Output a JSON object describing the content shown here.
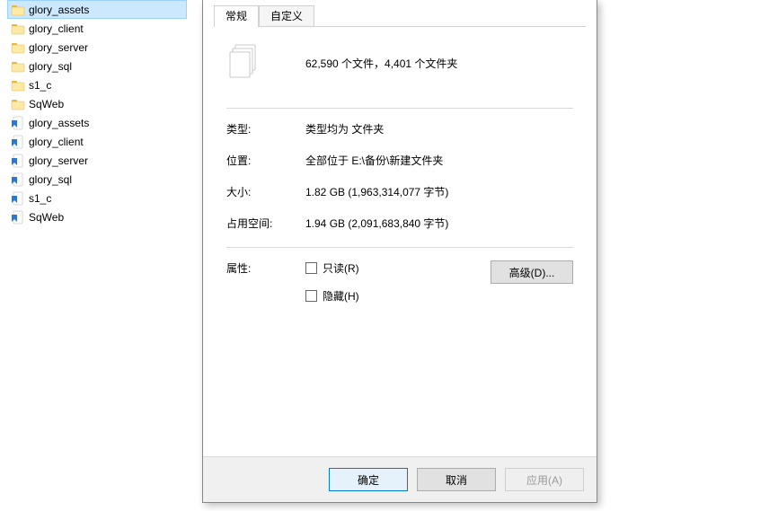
{
  "file_pane": {
    "items": [
      {
        "name": "glory_assets",
        "kind": "folder",
        "selected": true
      },
      {
        "name": "glory_client",
        "kind": "folder",
        "selected": false
      },
      {
        "name": "glory_server",
        "kind": "folder",
        "selected": false
      },
      {
        "name": "glory_sql",
        "kind": "folder",
        "selected": false
      },
      {
        "name": "s1_c",
        "kind": "folder",
        "selected": false
      },
      {
        "name": "SqWeb",
        "kind": "folder",
        "selected": false
      },
      {
        "name": "glory_assets",
        "kind": "bookmark",
        "selected": false
      },
      {
        "name": "glory_client",
        "kind": "bookmark",
        "selected": false
      },
      {
        "name": "glory_server",
        "kind": "bookmark",
        "selected": false
      },
      {
        "name": "glory_sql",
        "kind": "bookmark",
        "selected": false
      },
      {
        "name": "s1_c",
        "kind": "bookmark",
        "selected": false
      },
      {
        "name": "SqWeb",
        "kind": "bookmark",
        "selected": false
      }
    ]
  },
  "dialog": {
    "tabs": {
      "general": "常规",
      "custom": "自定义"
    },
    "summary": "62,590 个文件，4,401 个文件夹",
    "rows": {
      "type_label": "类型:",
      "type_value": "类型均为 文件夹",
      "location_label": "位置:",
      "location_value": "全部位于 E:\\备份\\新建文件夹",
      "size_label": "大小:",
      "size_value": "1.82 GB (1,963,314,077 字节)",
      "sizeondisk_label": "占用空间:",
      "sizeondisk_value": "1.94 GB (2,091,683,840 字节)",
      "attr_label": "属性:"
    },
    "attrs": {
      "readonly": "只读(R)",
      "hidden": "隐藏(H)"
    },
    "advanced_button": "高级(D)...",
    "buttons": {
      "ok": "确定",
      "cancel": "取消",
      "apply": "应用(A)"
    }
  }
}
